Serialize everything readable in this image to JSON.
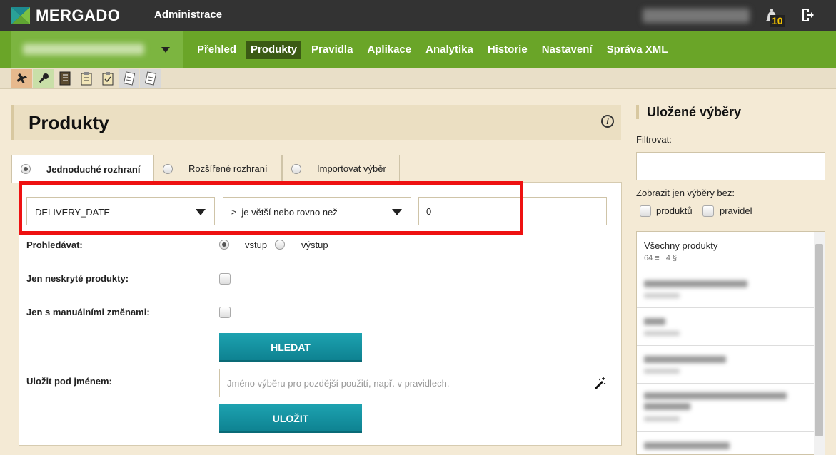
{
  "topbar": {
    "brand": "MERGADO",
    "section": "Administrace",
    "notifications": "10"
  },
  "nav": {
    "items": [
      "Přehled",
      "Produkty",
      "Pravidla",
      "Aplikace",
      "Analytika",
      "Historie",
      "Nastavení",
      "Správa XML"
    ],
    "active": "Produkty"
  },
  "toolbar": {
    "icons": [
      "tools-icon",
      "wrench-icon",
      "notebook-icon",
      "clipboard-icon",
      "clipboard-check-icon",
      "note-icon",
      "note-alt-icon"
    ]
  },
  "page": {
    "title": "Produkty"
  },
  "tabs": [
    {
      "label": "Jednoduché rozhraní",
      "active": true
    },
    {
      "label": "Rozšířené rozhraní",
      "active": false
    },
    {
      "label": "Importovat výběr",
      "active": false
    }
  ],
  "filter": {
    "field": "DELIVERY_DATE",
    "operator": "≥  je větší nebo rovno než",
    "value": "0"
  },
  "form": {
    "search_label": "Prohledávat:",
    "search_in": "vstup",
    "search_out": "výstup",
    "hidden_label": "Jen neskryté produkty:",
    "manual_label": "Jen s manuálními změnami:",
    "search_button": "HLEDAT",
    "save_label": "Uložit pod jménem:",
    "save_placeholder": "Jméno výběru pro pozdější použití, např. v pravidlech.",
    "save_button": "ULOŽIT"
  },
  "sidebar": {
    "title": "Uložené výběry",
    "filter_label": "Filtrovat:",
    "show_label": "Zobrazit jen výběry bez:",
    "opt_products": "produktů",
    "opt_rules": "pravidel",
    "first_item": {
      "title": "Všechny produkty",
      "meta": "64 ≡   4 §"
    }
  },
  "colors": {
    "topbar": "#333333",
    "green": "#6aa528",
    "button": "#1497a6",
    "highlight": "#ee1111"
  }
}
